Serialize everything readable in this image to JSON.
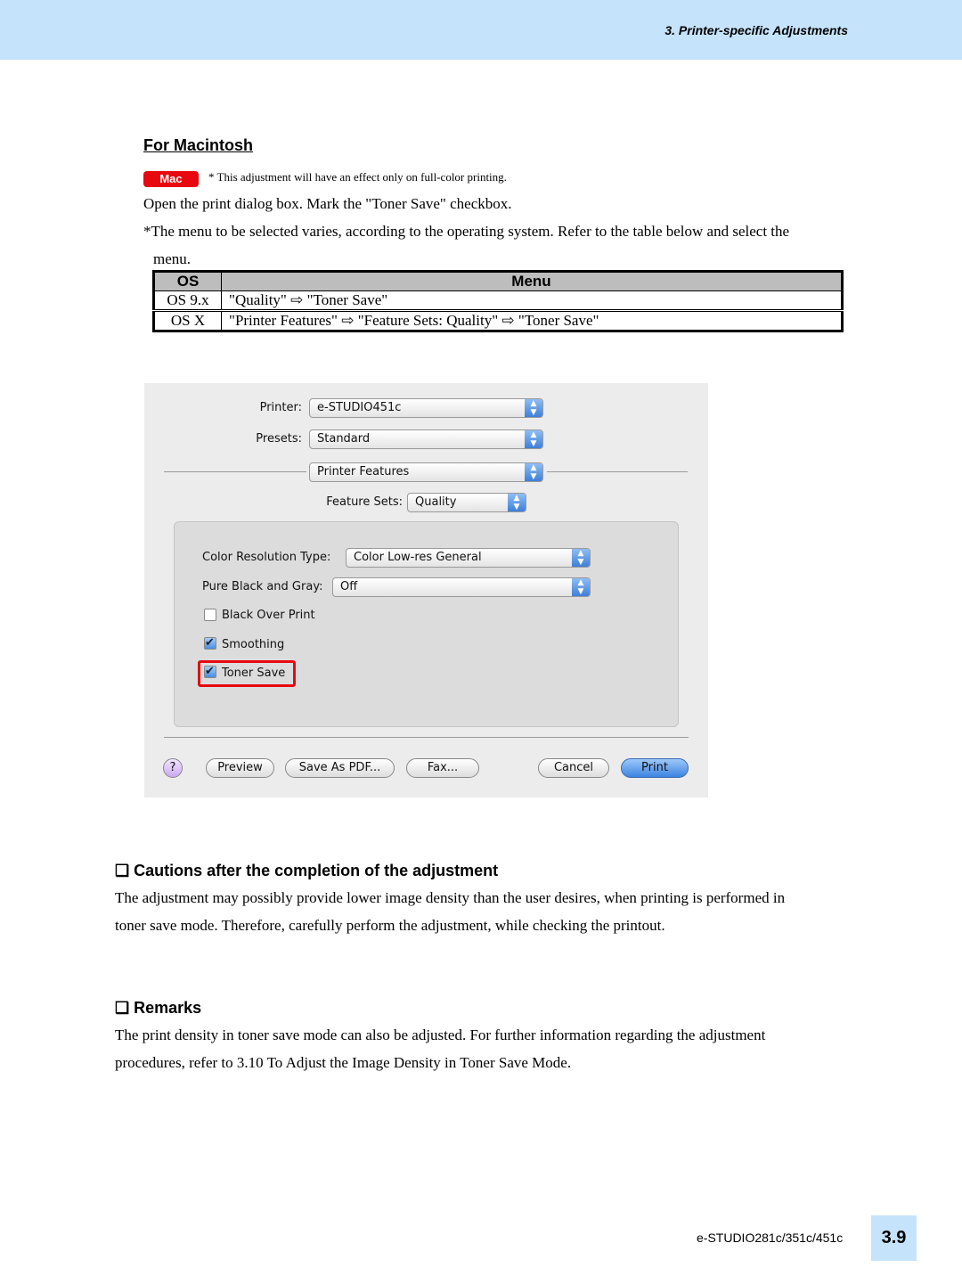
{
  "header": {
    "chapter": "3. Printer-specific Adjustments"
  },
  "mac_section": {
    "title": "For Macintosh",
    "badge": "Mac",
    "note": "* This adjustment will have an effect only on full-color printing.",
    "instruction": "Open the print dialog box.  Mark the \"Toner Save\" checkbox.",
    "menu_note_1": "*The menu to be selected varies, according to the operating system. Refer to the table below and select the",
    "menu_note_2": "menu."
  },
  "table": {
    "headers": [
      "OS",
      "Menu"
    ],
    "rows": [
      [
        "OS 9.x",
        "\"Quality\" ⇨ \"Toner Save\""
      ],
      [
        "OS X",
        "\"Printer Features\" ⇨ \"Feature Sets: Quality\" ⇨ \"Toner Save\""
      ]
    ]
  },
  "dialog": {
    "printer_label": "Printer:",
    "printer_value": "e-STUDIO451c",
    "presets_label": "Presets:",
    "presets_value": "Standard",
    "panel_value": "Printer Features",
    "feature_sets_label": "Feature Sets:",
    "feature_sets_value": "Quality",
    "color_res_label": "Color Resolution Type:",
    "color_res_value": "Color Low-res General",
    "pure_black_label": "Pure Black and Gray:",
    "pure_black_value": "Off",
    "checkboxes": [
      {
        "label": "Black Over Print",
        "checked": false
      },
      {
        "label": "Smoothing",
        "checked": true
      },
      {
        "label": "Toner Save",
        "checked": true
      }
    ],
    "buttons": {
      "help": "?",
      "preview": "Preview",
      "save_pdf": "Save As PDF...",
      "fax": "Fax...",
      "cancel": "Cancel",
      "print": "Print"
    },
    "highlight_color": "#e8080f"
  },
  "cautions": {
    "title": "Cautions after the completion of the adjustment",
    "line1": "The adjustment may possibly provide lower image density than the user desires, when printing is performed in",
    "line2": "toner save mode.  Therefore, carefully perform the adjustment, while checking the printout."
  },
  "remarks": {
    "title": "Remarks",
    "line1": "The print density in toner save mode can also be adjusted.  For further information regarding the adjustment",
    "line2": "procedures, refer to 3.10 To Adjust the Image Density in Toner Save Mode."
  },
  "footer": {
    "model": "e-STUDIO281c/351c/451c",
    "page": "3.9"
  }
}
